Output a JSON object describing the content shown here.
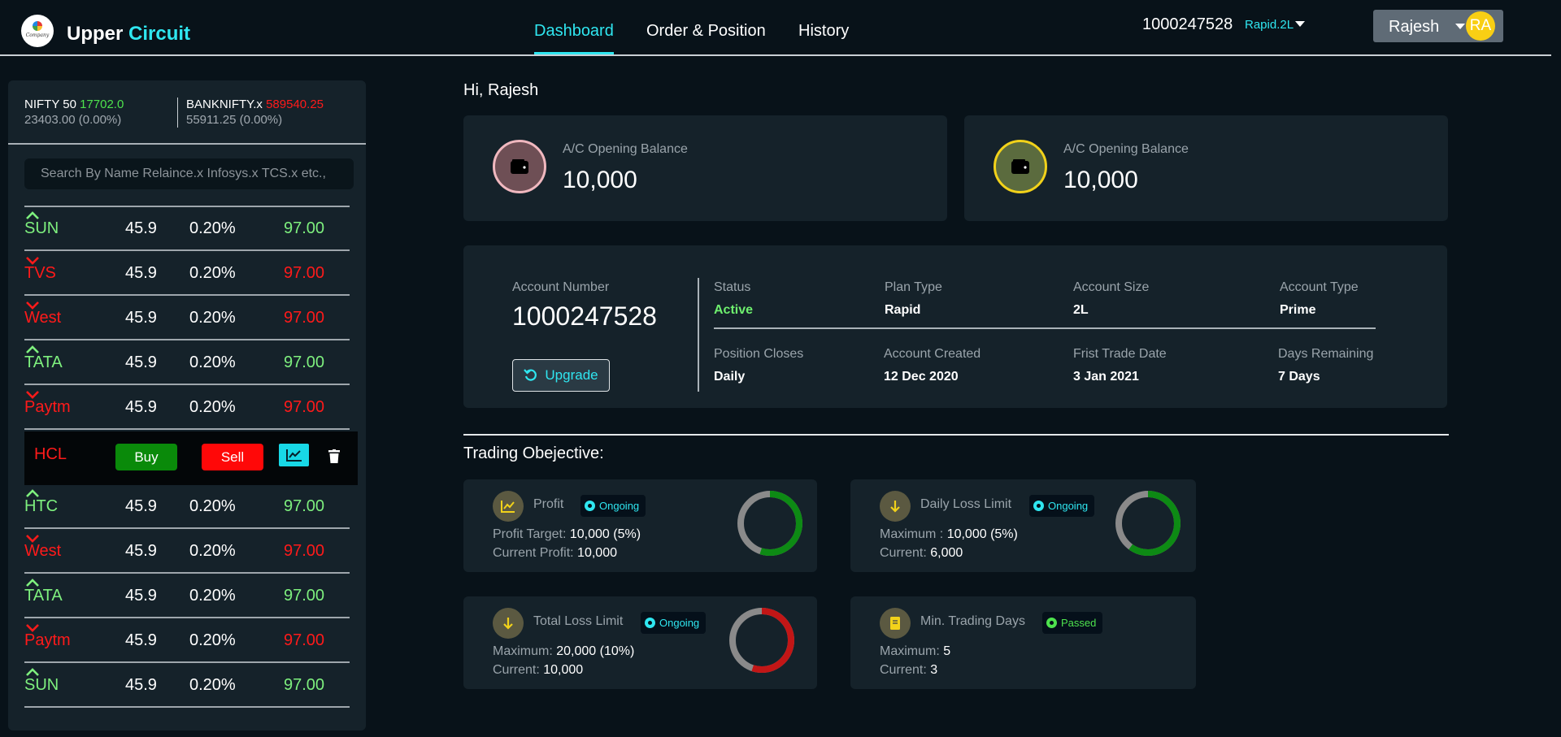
{
  "header": {
    "brand_1": "Upper",
    "brand_2": "Circuit",
    "logo_text": "Company",
    "nav": [
      "Dashboard",
      "Order & Position",
      "History"
    ],
    "active_nav": "Dashboard",
    "account_number": "1000247528",
    "plan": "Rapid.2L",
    "user_name": "Rajesh",
    "avatar_initials": "RA"
  },
  "indices": [
    {
      "name": "NIFTY 50",
      "value": "17702.0",
      "sub": "23403.00 (0.00%)",
      "color": "#4de24d"
    },
    {
      "name": "BANKNIFTY.x",
      "value": "589540.25",
      "sub": "55911.25 (0.00%)",
      "color": "#ff1a1a"
    }
  ],
  "search": {
    "placeholder": "Search By Name Relaince.x Infosys.x TCS.x etc.,"
  },
  "watchlist": [
    {
      "symbol": "SUN",
      "price": "45.9",
      "change": "0.20%",
      "direction": "up",
      "value": "97.00"
    },
    {
      "symbol": "TVS",
      "price": "45.9",
      "change": "0.20%",
      "direction": "down",
      "value": "97.00"
    },
    {
      "symbol": "West",
      "price": "45.9",
      "change": "0.20%",
      "direction": "down",
      "value": "97.00"
    },
    {
      "symbol": "TATA",
      "price": "45.9",
      "change": "0.20%",
      "direction": "up",
      "value": "97.00"
    },
    {
      "symbol": "Paytm",
      "price": "45.9",
      "change": "0.20%",
      "direction": "down",
      "value": "97.00"
    },
    {
      "symbol": "HTC",
      "price": "45.9",
      "change": "0.20%",
      "direction": "up",
      "value": "97.00"
    },
    {
      "symbol": "West",
      "price": "45.9",
      "change": "0.20%",
      "direction": "down",
      "value": "97.00"
    },
    {
      "symbol": "TATA",
      "price": "45.9",
      "change": "0.20%",
      "direction": "up",
      "value": "97.00"
    },
    {
      "symbol": "Paytm",
      "price": "45.9",
      "change": "0.20%",
      "direction": "down",
      "value": "97.00"
    },
    {
      "symbol": "SUN",
      "price": "45.9",
      "change": "0.20%",
      "direction": "up",
      "value": "97.00"
    }
  ],
  "selected_row": {
    "symbol": "HCL",
    "buy_label": "Buy",
    "sell_label": "Sell"
  },
  "main": {
    "greeting": "Hi, Rajesh",
    "balances": [
      {
        "label": "A/C Opening Balance",
        "amount": "10,000",
        "icon_bg": "#6e4f55",
        "icon_ring": "#f0b8bf"
      },
      {
        "label": "A/C Opening Balance",
        "amount": "10,000",
        "icon_bg": "#5b6b3e",
        "icon_ring": "#f2d21a"
      }
    ],
    "account": {
      "number_label": "Account Number",
      "number": "1000247528",
      "upgrade_label": "Upgrade",
      "status_label": "Status",
      "status": "Active",
      "plan_type_label": "Plan Type",
      "plan_type": "Rapid",
      "size_label": "Account Size",
      "size": "2L",
      "type_label": "Account Type",
      "type": "Prime",
      "position_closes_label": "Position Closes",
      "position_closes": "Daily",
      "created_label": "Account Created",
      "created": "12 Dec 2020",
      "first_trade_label": "Frist Trade Date",
      "first_trade": "3 Jan 2021",
      "days_remaining_label": "Days Remaining",
      "days_remaining": "7 Days"
    },
    "objective_title": "Trading Obejective:",
    "objectives": [
      {
        "title": "Profit",
        "status": "Ongoing",
        "line1_label": "Profit Target:",
        "line1_value": "10,000 (5%)",
        "line2_label": "Current Profit:",
        "line2_value": "10,000",
        "progress": 0.55,
        "ring_color": "#0d8a14"
      },
      {
        "title": "Daily Loss Limit",
        "status": "Ongoing",
        "line1_label": "Maximum :",
        "line1_value": "10,000 (5%)",
        "line2_label": "Current:",
        "line2_value": "6,000",
        "progress": 0.6,
        "ring_color": "#0d8a14"
      },
      {
        "title": "Total Loss Limit",
        "status": "Ongoing",
        "line1_label": "Maximum:",
        "line1_value": "20,000 (10%)",
        "line2_label": "Current:",
        "line2_value": "10,000",
        "progress": 0.55,
        "ring_color": "#c21616"
      },
      {
        "title": "Min. Trading Days",
        "status": "Passed",
        "line1_label": "Maximum:",
        "line1_value": "5",
        "line2_label": "Current:",
        "line2_value": "3",
        "progress": null,
        "ring_color": null
      }
    ]
  },
  "icons": {
    "wallet": "wallet-icon",
    "chart": "chart-line-icon",
    "trash": "trash-icon",
    "refresh": "refresh-icon",
    "arrow_up": "chevron-up-icon",
    "arrow_down": "chevron-down-icon"
  }
}
